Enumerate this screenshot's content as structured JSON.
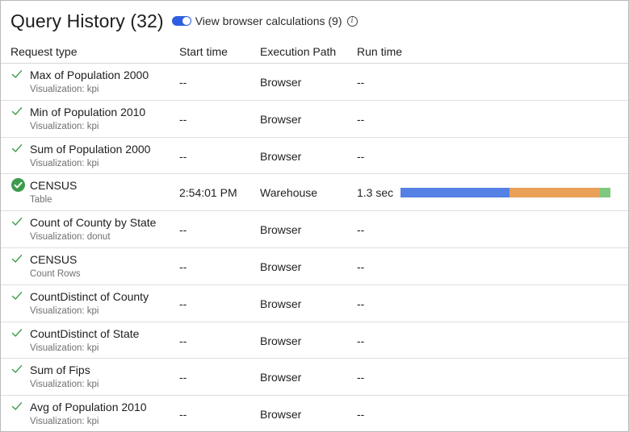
{
  "header": {
    "title": "Query History (32)",
    "toggle_label": "View browser calculations (9)",
    "toggle_on": true
  },
  "columns": [
    "Request type",
    "Start time",
    "Execution Path",
    "Run time"
  ],
  "colors": {
    "toggle": "#2f5fe0",
    "check": "#3c9c4c",
    "bar_segments": [
      "#5580e4",
      "#e8a157",
      "#7ec97f"
    ]
  },
  "rows": [
    {
      "status": "check",
      "title": "Max of Population 2000",
      "subtitle": "Visualization: kpi",
      "start": "--",
      "path": "Browser",
      "runtime": "--"
    },
    {
      "status": "check",
      "title": "Min of Population 2010",
      "subtitle": "Visualization: kpi",
      "start": "--",
      "path": "Browser",
      "runtime": "--"
    },
    {
      "status": "check",
      "title": "Sum of Population 2000",
      "subtitle": "Visualization: kpi",
      "start": "--",
      "path": "Browser",
      "runtime": "--"
    },
    {
      "status": "filled",
      "title": "CENSUS",
      "subtitle": "Table",
      "start": "2:54:01 PM",
      "path": "Warehouse",
      "runtime": "1.3 sec",
      "bar": [
        0.52,
        0.43,
        0.05
      ]
    },
    {
      "status": "check",
      "title": "Count of County by State",
      "subtitle": "Visualization: donut",
      "start": "--",
      "path": "Browser",
      "runtime": "--"
    },
    {
      "status": "check",
      "title": "CENSUS",
      "subtitle": "Count Rows",
      "start": "--",
      "path": "Browser",
      "runtime": "--"
    },
    {
      "status": "check",
      "title": "CountDistinct of County",
      "subtitle": "Visualization: kpi",
      "start": "--",
      "path": "Browser",
      "runtime": "--"
    },
    {
      "status": "check",
      "title": "CountDistinct of State",
      "subtitle": "Visualization: kpi",
      "start": "--",
      "path": "Browser",
      "runtime": "--"
    },
    {
      "status": "check",
      "title": "Sum of Fips",
      "subtitle": "Visualization: kpi",
      "start": "--",
      "path": "Browser",
      "runtime": "--"
    },
    {
      "status": "check",
      "title": "Avg of Population 2010",
      "subtitle": "Visualization: kpi",
      "start": "--",
      "path": "Browser",
      "runtime": "--"
    }
  ]
}
